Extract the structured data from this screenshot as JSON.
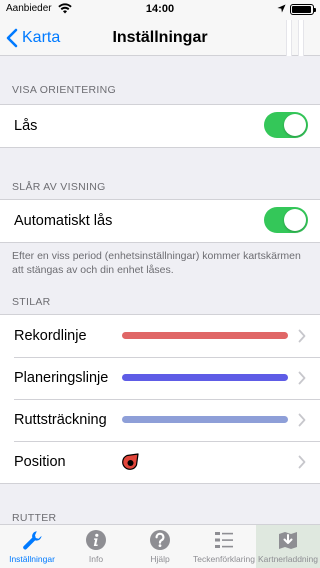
{
  "status_bar": {
    "carrier": "Aanbieder",
    "time": "14:00"
  },
  "nav": {
    "back_label": "Karta",
    "title": "Inställningar"
  },
  "sections": {
    "orientation": {
      "header": "VISA ORIENTERING",
      "lock_label": "Lås",
      "lock_on": true
    },
    "sleep": {
      "header": "SLÅR AV VISNING",
      "auto_lock_label": "Automatiskt lås",
      "auto_lock_on": true,
      "footer": "Efter en viss period (enhetsinställningar) kommer kartskärmen att stängas av och din enhet låses."
    },
    "styles": {
      "header": "STILAR",
      "items": [
        {
          "label": "Rekordlinje",
          "color": "#e06666"
        },
        {
          "label": "Planeringslinje",
          "color": "#5e5ce6"
        },
        {
          "label": "Ruttsträckning",
          "color": "#8e9fd8"
        },
        {
          "label": "Position",
          "icon": "position-marker-icon",
          "color": "#e0453a"
        }
      ]
    },
    "routes": {
      "header": "RUTTER"
    }
  },
  "colors": {
    "accent": "#007aff",
    "toggle_on": "#34c759"
  },
  "tabbar": {
    "tabs": [
      {
        "label": "Inställningar",
        "icon": "wrench-icon",
        "active": true
      },
      {
        "label": "Info",
        "icon": "info-icon"
      },
      {
        "label": "Hjälp",
        "icon": "help-icon"
      },
      {
        "label": "Teckenförklaring",
        "icon": "legend-icon"
      },
      {
        "label": "Kartnerladdning",
        "icon": "map-download-icon"
      }
    ]
  }
}
